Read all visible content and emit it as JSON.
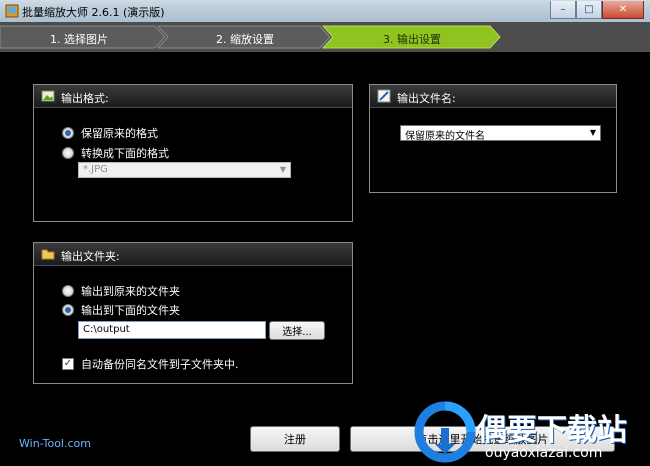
{
  "window": {
    "title": "批量缩放大师 2.6.1 (演示版)",
    "buttons": {
      "minimize": "–",
      "maximize": "□",
      "close": "✕"
    }
  },
  "steps": [
    {
      "label": "1. 选择图片",
      "active": false
    },
    {
      "label": "2. 缩放设置",
      "active": false
    },
    {
      "label": "3. 输出设置",
      "active": true
    }
  ],
  "output_format": {
    "title": "输出格式:",
    "options": [
      {
        "label": "保留原来的格式",
        "selected": true
      },
      {
        "label": "转换成下面的格式",
        "selected": false
      }
    ],
    "format_value": "*.JPG"
  },
  "output_filename": {
    "title": "输出文件名:",
    "selected": "保留原来的文件名"
  },
  "output_folder": {
    "title": "输出文件夹:",
    "options": [
      {
        "label": "输出到原来的文件夹",
        "selected": false
      },
      {
        "label": "输出到下面的文件夹",
        "selected": true
      }
    ],
    "path": "C:\\output",
    "browse_label": "选择...",
    "backup_label": "自动备份同名文件到子文件夹中.",
    "backup_checked": true
  },
  "footer": {
    "brand": "Win-Tool.com",
    "register_label": "注册",
    "start_label": "点击这里开始批量缩放图片"
  },
  "watermark": {
    "name": "偶要下载站",
    "url": "ouyaoxiazai.com"
  },
  "colors": {
    "active_step": "#8fc31f",
    "inactive_step": "#5a5a5a",
    "link_blue": "#6cb4ff"
  }
}
